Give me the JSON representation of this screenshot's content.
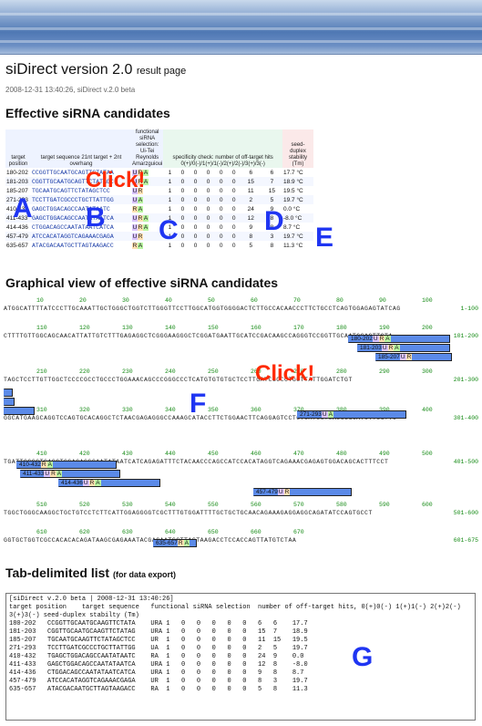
{
  "header": {
    "app_name": "siDirect",
    "version": "version 2.0",
    "page_label": "result page",
    "timestamp": "2008-12-31 13:40:26, siDirect v.2.0 beta"
  },
  "sections": {
    "effective": "Effective siRNA candidates",
    "graphical": "Graphical view of effective siRNA candidates",
    "tablist": "Tab-delimited list",
    "tablist_note": "(for data export)"
  },
  "table": {
    "col_target": "target position",
    "col_seq": "target sequence 21nt target + 2nt overhang",
    "col_func": "functional siRNA selection: Ui-Tei Reynolds Amarzguioui",
    "col_spec": "specificity check: number of off-target hits",
    "col_spec_sub": "0(+)/0(-)/1(+)/1(-)/2(+)/2(-)/3(+)/3(-)",
    "col_seed": "seed-duplex stability (Tm)",
    "rows": [
      {
        "pos": "180-202",
        "seq": "CCGGTTGCAATGCAGTTCTATAA",
        "sel": [
          "U",
          "R",
          "A"
        ],
        "hits": [
          "1",
          "0",
          "0",
          "0",
          "0",
          "0",
          "6",
          "6"
        ],
        "tm": "17.7 °C"
      },
      {
        "pos": "181-203",
        "seq": "CGGTTGCAATGCAGTTCTATAGC",
        "sel": [
          "U",
          "R",
          "A"
        ],
        "hits": [
          "1",
          "0",
          "0",
          "0",
          "0",
          "0",
          "15",
          "7"
        ],
        "tm": "18.9 °C"
      },
      {
        "pos": "185-207",
        "seq": "TGCAATGCAGTTCTATAGCTCC",
        "sel": [
          "U",
          "R",
          ""
        ],
        "hits": [
          "1",
          "0",
          "0",
          "0",
          "0",
          "0",
          "11",
          "15"
        ],
        "tm": "19.5 °C"
      },
      {
        "pos": "271-293",
        "seq": "TCCTTGATCGCCCTGCTTATTGG",
        "sel": [
          "U",
          "A",
          ""
        ],
        "hits": [
          "1",
          "0",
          "0",
          "0",
          "0",
          "0",
          "2",
          "5"
        ],
        "tm": "19.7 °C"
      },
      {
        "pos": "410-432",
        "seq": "GAGCTGGACAGCCAATATAATC",
        "sel": [
          "R",
          "A",
          ""
        ],
        "hits": [
          "1",
          "0",
          "0",
          "0",
          "0",
          "0",
          "24",
          "9"
        ],
        "tm": "0.0 °C"
      },
      {
        "pos": "411-433",
        "seq": "GAGCTGGACAGCCAATATAATCA",
        "sel": [
          "U",
          "R",
          "A"
        ],
        "hits": [
          "1",
          "0",
          "0",
          "0",
          "0",
          "0",
          "12",
          "8"
        ],
        "tm": "-8.0 °C"
      },
      {
        "pos": "414-436",
        "seq": "CTGGACAGCCAATATAATCATCA",
        "sel": [
          "U",
          "R",
          "A"
        ],
        "hits": [
          "1",
          "0",
          "0",
          "0",
          "0",
          "0",
          "9",
          "8"
        ],
        "tm": "8.7 °C"
      },
      {
        "pos": "457-479",
        "seq": "ATCCACATAGGTCAGAAACGAGA",
        "sel": [
          "U",
          "R",
          ""
        ],
        "hits": [
          "1",
          "0",
          "0",
          "0",
          "0",
          "0",
          "8",
          "3"
        ],
        "tm": "19.7 °C"
      },
      {
        "pos": "635-657",
        "seq": "ATACGACAATGCTTAGTAAGACC",
        "sel": [
          "R",
          "A",
          ""
        ],
        "hits": [
          "1",
          "0",
          "0",
          "0",
          "0",
          "0",
          "5",
          "8"
        ],
        "tm": "11.3 °C"
      }
    ]
  },
  "annotations": {
    "A": "A",
    "B": "B",
    "C": "C",
    "D": "D",
    "E": "E",
    "F": "F",
    "G": "G",
    "click1": "Click!",
    "click2": "Click!"
  },
  "graph": {
    "lines": [
      {
        "ticks": [
          "10",
          "20",
          "30",
          "40",
          "50",
          "60",
          "70",
          "80",
          "90",
          "100"
        ],
        "seq": "ATGGCATTTTATCCCTTGCAAATTGCTGGGCTGGTCTTGGGTTCCTTGGCATGGTGGGGACTCTTGCCACAACCCTTCTGCCTCAGTGGAGAGTATCAG",
        "range": "1-100"
      },
      {
        "ticks": [
          "110",
          "120",
          "130",
          "140",
          "150",
          "160",
          "170",
          "180",
          "190",
          "200"
        ],
        "seq": "CTTTTGTTGGCAGCAACATTATTGTCTTTGAGAGGCTCGGGAAGGGCTCGGATGAATTGCATCCGACAAGCCAGGGTCCGGTTGCAATGCAGTTCTA",
        "range": "101-200"
      },
      {
        "ticks": [
          "210",
          "220",
          "230",
          "240",
          "250",
          "260",
          "270",
          "280",
          "290",
          "300"
        ],
        "seq": "TAGCTCCTTGTTGGCTCCCCGCCTGCCCTGGAAACAGCCCGGGCCCTCATGTGTGTGCTCCTTGATCGCCCTGCTTATTGGATCTGT",
        "range": "201-300"
      },
      {
        "ticks": [
          "310",
          "320",
          "330",
          "340",
          "350",
          "360",
          "370",
          "380",
          "390",
          "400"
        ],
        "seq": "GGCATGAAGCAGGTCCAGTGCACAGGCTCTAACGAGAGGGCCAAAGCATACCTTCTGGAACTTCAGGAGTCCTCTCATCCTCACGGGCATCTTCGTTC",
        "range": "301-400"
      },
      {
        "ticks": [
          "410",
          "420",
          "430",
          "440",
          "450",
          "460",
          "470",
          "480",
          "490",
          "500"
        ],
        "seq": "TGATTCCGGTGAGCTGGACAGCCAATATAATCATCAGAGATTTCTACAACCCAGCCATCCACATAGGTCAGAAACGAGAGTGGACAGCACTTTCCT",
        "range": "401-500"
      },
      {
        "ticks": [
          "510",
          "520",
          "530",
          "540",
          "550",
          "560",
          "570",
          "580",
          "590",
          "600"
        ],
        "seq": "TGGCTGGGCAAGGCTGCTGTCCTCTTCATTGGAGGGGTCGCTTTGTGGATTTTGCTGCTGCAACAGAAAGAGGAGGCAGATATCCAGTGCCT",
        "range": "501-600"
      },
      {
        "ticks": [
          "610",
          "620",
          "630",
          "640",
          "650",
          "660",
          "670"
        ],
        "seq": "GGTGCTGGTCGCCACACACAGATAAGCGAGAAATACGACAATGCTTAGTAAGACCTCCACCAGTTATGTCTAA",
        "range": "601-675"
      }
    ],
    "bars": [
      {
        "label": "180-202",
        "tags": [
          "U",
          "R",
          "A"
        ]
      },
      {
        "label": "181-203",
        "tags": [
          "U",
          "R",
          "A"
        ]
      },
      {
        "label": "185-207",
        "tags": [
          "U",
          "R"
        ]
      },
      {
        "label": "271-293",
        "tags": [
          "U",
          "A"
        ]
      },
      {
        "label": "410-432",
        "tags": [
          "R",
          "A"
        ]
      },
      {
        "label": "411-433",
        "tags": [
          "U",
          "R",
          "A"
        ]
      },
      {
        "label": "414-436",
        "tags": [
          "U",
          "R",
          "A"
        ]
      },
      {
        "label": "457-479",
        "tags": [
          "U",
          "R"
        ]
      },
      {
        "label": "635-657",
        "tags": [
          "R",
          "A"
        ]
      }
    ]
  },
  "tablist": {
    "text": "[siDirect v.2.0 beta | 2008-12-31 13:40:26]\ntarget position    target sequence   functional siRNA selection  number of off-target hits, 0(+)0(-) 1(+)1(-) 2(+)2(-)\n3(+)3(-) seed-duplex stabilty (Tm)\n180-202   CCGGTTGCAATGCAAGTTCTATA    URA 1   0   0   0   0   0   6   6    17.7\n181-203   CGGTTGCAATGCAAGTTCTATAG    URA 1   0   0   0   0   0   15  7    18.9\n185-207   TGCAATGCAAGTTCTATAGCTCC    UR  1   0   0   0   0   0   11  15   19.5\n271-293   TCCTTGATCGCCCTGCTTATTGG    UA  1   0   0   0   0   0   2   5    19.7\n410-432   TGAGCTGGACAGCCAATATAATC    RA  1   0   0   0   0   0   24  9    0.0\n411-433   GAGCTGGACAGCCAATATAATCA    URA 1   0   0   0   0   0   12  8    -8.0\n414-436   CTGGACAGCCAATATAATCATCA    URA 1   0   0   0   0   0   9   8    8.7\n457-479   ATCCACATAGGTCAGAAACGAGA    UR  1   0   0   0   0   0   8   3    19.7\n635-657   ATACGACAATGCTTAGTAAGACC    RA  1   0   0   0   0   0   5   8    11.3"
  }
}
